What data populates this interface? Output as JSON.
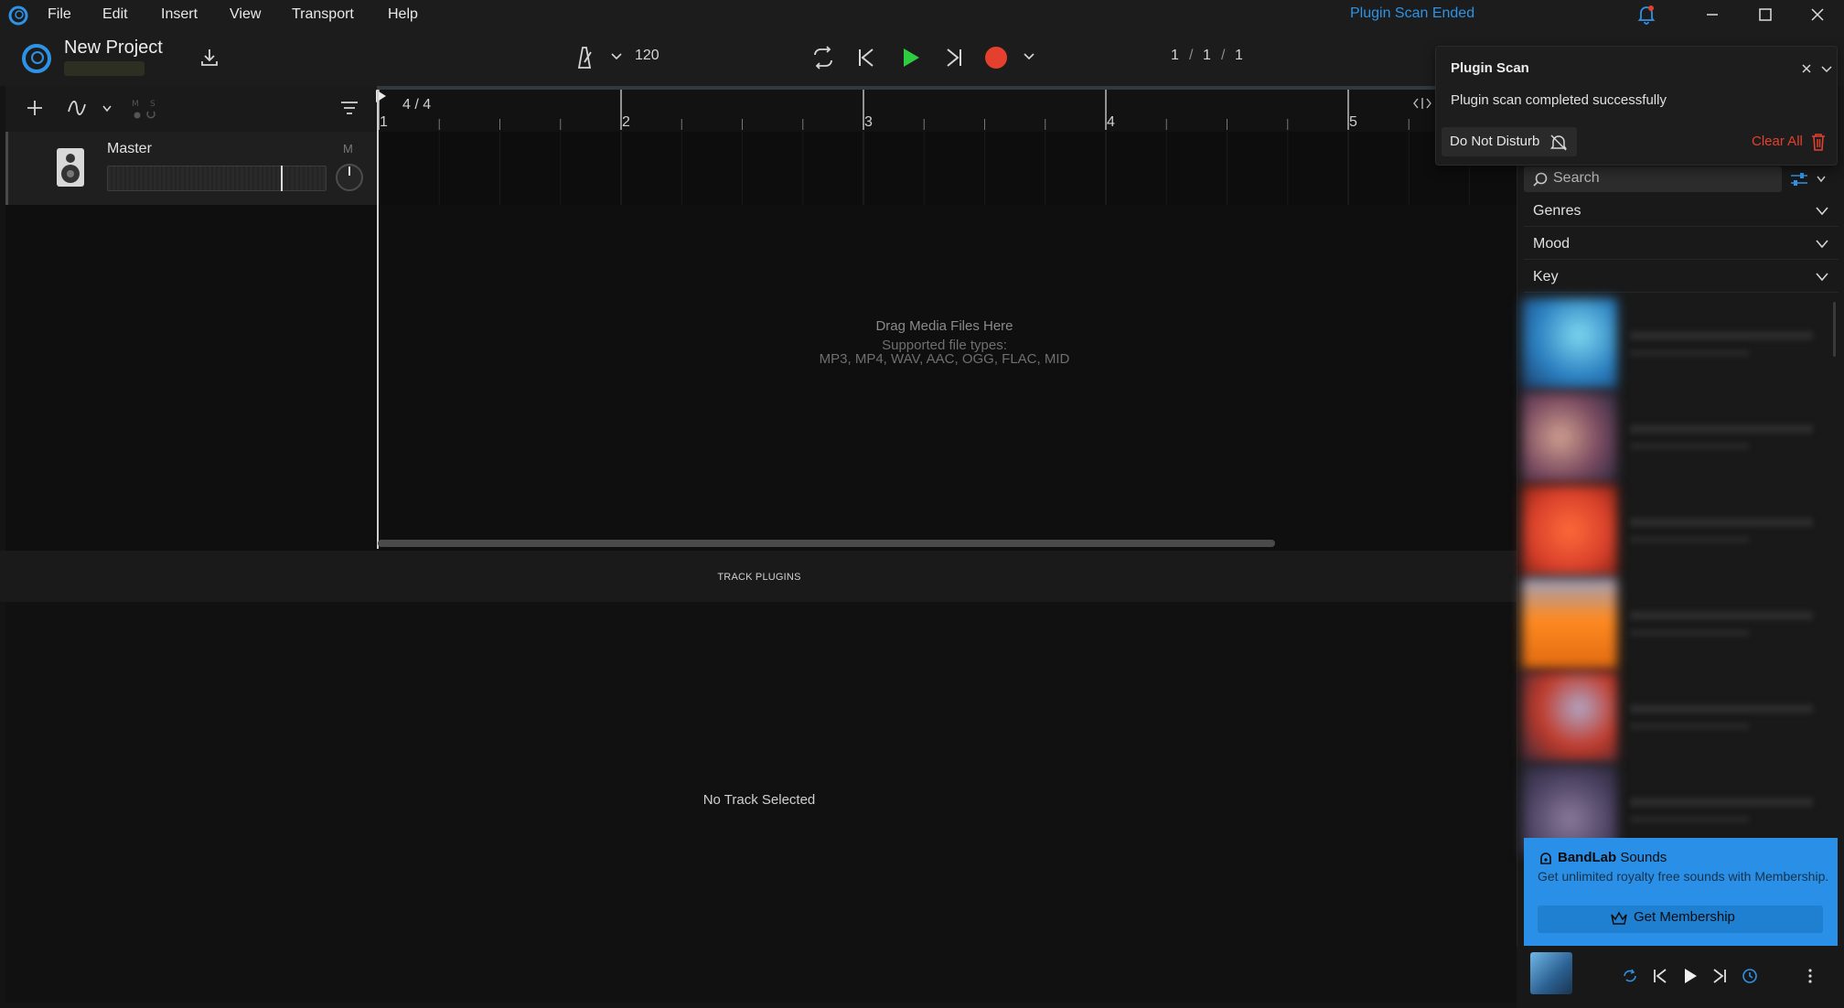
{
  "menu": {
    "items": [
      "File",
      "Edit",
      "Insert",
      "View",
      "Transport",
      "Help"
    ],
    "scan_status": "Plugin Scan Ended"
  },
  "project": {
    "name": "New Project"
  },
  "transport": {
    "tempo": "120",
    "position_bar": "1",
    "position_beat": "1",
    "position_tick": "1",
    "sep": "/"
  },
  "tracks": {
    "master": {
      "name": "Master",
      "mute_label": "M",
      "volume_fraction": 0.8
    }
  },
  "timeline": {
    "time_signature": "4 / 4",
    "bars": [
      "1",
      "2",
      "3",
      "4",
      "5"
    ],
    "drop_title": "Drag Media Files Here",
    "drop_sub": "Supported file types:",
    "drop_types": "MP3, MP4, WAV, AAC, OGG, FLAC, MID"
  },
  "plugins": {
    "header": "TRACK PLUGINS",
    "empty": "No Track Selected"
  },
  "browser": {
    "search_placeholder": "Search",
    "filters": [
      "Genres",
      "Mood",
      "Key"
    ]
  },
  "promo": {
    "title_bold": "BandLab",
    "title_rest": " Sounds",
    "description": "Get unlimited royalty free sounds with Membership.",
    "button": "Get Membership"
  },
  "notification": {
    "title": "Plugin Scan",
    "message": "Plugin scan completed successfully",
    "dnd_label": "Do Not Disturb",
    "clear_label": "Clear All"
  },
  "colors": {
    "accent": "#2e93e6",
    "play": "#2ecc40",
    "record": "#e3402e",
    "promo_bg": "#2a8fe6"
  }
}
